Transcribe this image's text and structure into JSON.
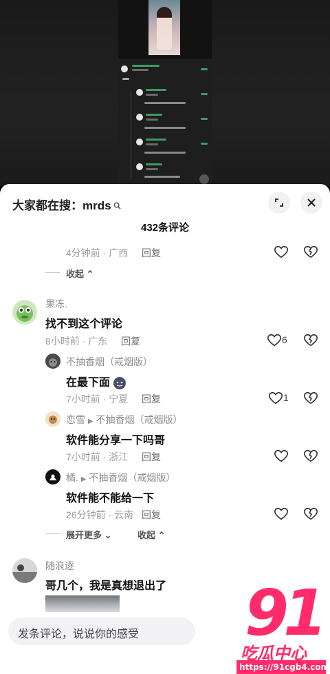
{
  "sheet": {
    "search_hint_prefix": "大家都在搜：",
    "search_keyword": "mrds",
    "comment_count_title": "432条评论",
    "expand_icon": "fullscreen-icon",
    "close_icon": "close-icon"
  },
  "comments": {
    "prev_tail": {
      "meta": "4分钟前 · 广西",
      "reply": "回复",
      "collapse": "收起"
    },
    "c1": {
      "name": "果冻.",
      "text": "找不到这个评论",
      "meta": "8小时前 · 广东",
      "reply": "回复",
      "likes": "6"
    },
    "r1": {
      "name": "不抽香烟（戒烟版）",
      "text": "在最下面",
      "meta": "7小时前 · 宁夏",
      "reply": "回复",
      "likes": "1"
    },
    "r2": {
      "name": "恋雪",
      "target": "不抽香烟（戒烟版）",
      "text": "软件能分享一下吗哥",
      "meta": "7小时前 · 浙江",
      "reply": "回复"
    },
    "r3": {
      "name": "橘.",
      "target": "不抽香烟（戒烟版）",
      "text": "软件能不能给一下",
      "meta": "26分钟前 · 云南",
      "reply": "回复"
    },
    "more": {
      "expand": "展开更多",
      "collapse": "收起"
    },
    "c2": {
      "name": "随浪逐",
      "text": "哥几个，我是真想退出了"
    }
  },
  "input": {
    "placeholder": "发条评论，说说你的感受"
  },
  "watermark": {
    "big": "91",
    "cn": "吃瓜中心",
    "url": "https://91cgb4.com"
  },
  "mini_preview": {
    "lines": [
      "顾?",
      "@玩元神着了我一命 破防了",
      "@玩元神着了我一命 开局了",
      "@玩元神着了我一命 开局了",
      "@玩元神着了我一命?"
    ]
  },
  "colors": {
    "accent": "#ff2b6a",
    "text": "#111111",
    "muted": "#9c9ca0"
  }
}
